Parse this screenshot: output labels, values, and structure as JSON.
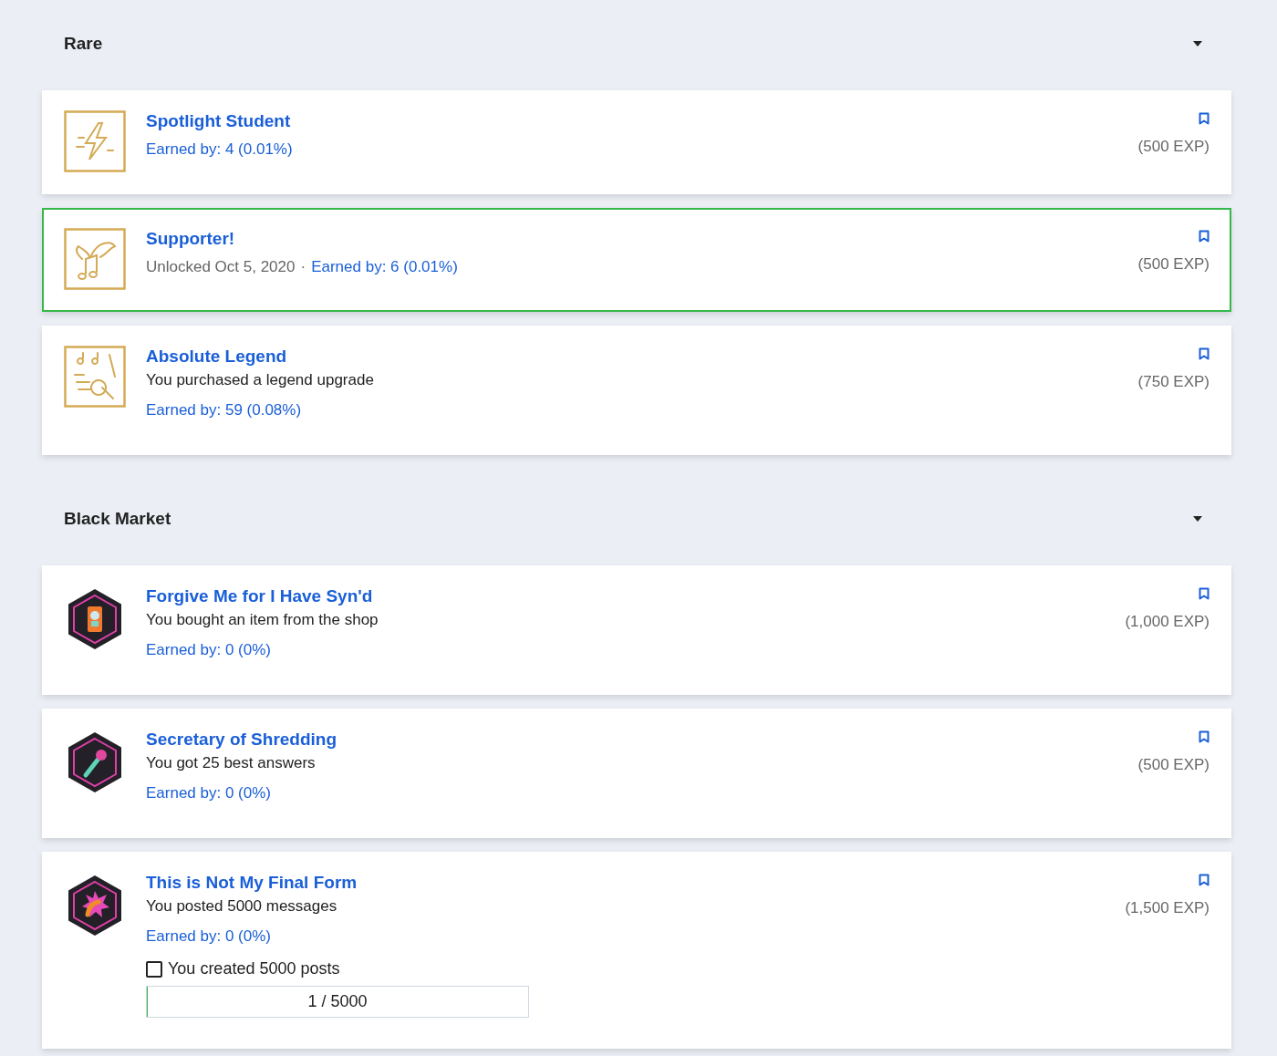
{
  "sections": [
    {
      "title": "Rare",
      "expanded": true,
      "items": [
        {
          "kind": "gold",
          "title": "Spotlight Student",
          "earned": "Earned by: 4 (0.01%)",
          "exp": "(500 EXP)",
          "unlocked": false
        },
        {
          "kind": "gold",
          "title": "Supporter!",
          "unlocked_text": "Unlocked Oct 5, 2020",
          "separator": "·",
          "earned": "Earned by: 6 (0.01%)",
          "exp": "(500 EXP)",
          "unlocked": true
        },
        {
          "kind": "gold",
          "title": "Absolute Legend",
          "description": "You purchased a legend upgrade",
          "earned": "Earned by: 59 (0.08%)",
          "exp": "(750 EXP)",
          "unlocked": false
        }
      ]
    },
    {
      "title": "Black Market",
      "expanded": true,
      "items": [
        {
          "kind": "hex",
          "title": "Forgive Me for I Have Syn'd",
          "description": "You bought an item from the shop",
          "earned": "Earned by: 0 (0%)",
          "exp": "(1,000 EXP)",
          "unlocked": false
        },
        {
          "kind": "hex",
          "title": "Secretary of Shredding",
          "description": "You got 25 best answers",
          "earned": "Earned by: 0 (0%)",
          "exp": "(500 EXP)",
          "unlocked": false
        },
        {
          "kind": "hex",
          "title": "This is Not My Final Form",
          "description": "You posted 5000 messages",
          "earned": "Earned by: 0 (0%)",
          "exp": "(1,500 EXP)",
          "unlocked": false,
          "criteria": [
            {
              "label": "You created 5000 posts",
              "checked": false,
              "progress": "1 / 5000",
              "level": 0.0002
            }
          ]
        }
      ]
    }
  ]
}
